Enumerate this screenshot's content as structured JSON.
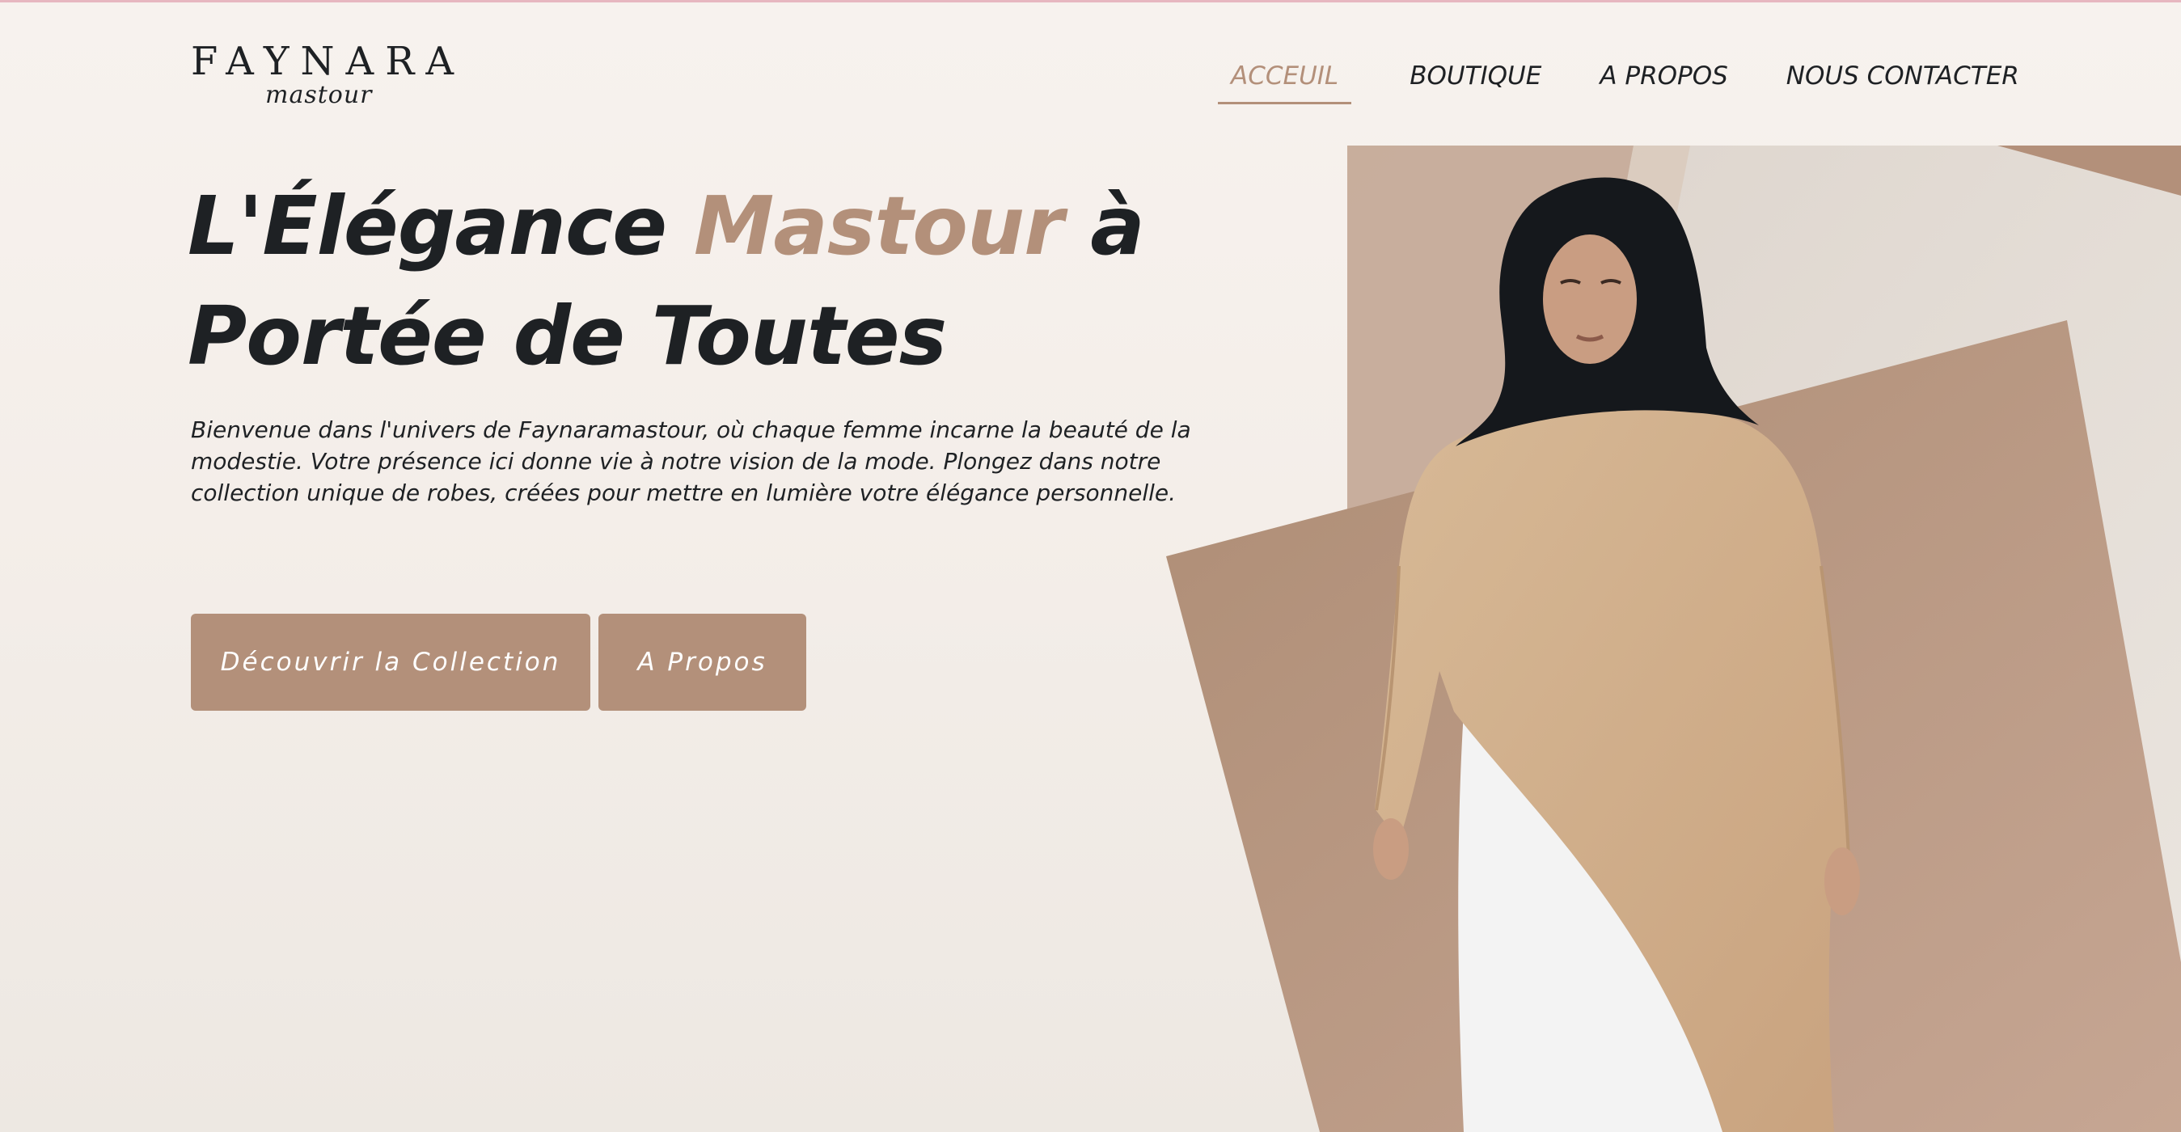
{
  "brand": {
    "name": "FAYNARA",
    "tagline": "mastour"
  },
  "nav": {
    "items": [
      {
        "label": "ACCEUIL",
        "active": true
      },
      {
        "label": "BOUTIQUE",
        "active": false
      },
      {
        "label": "A PROPOS",
        "active": false
      },
      {
        "label": "NOUS CONTACTER",
        "active": false
      }
    ]
  },
  "hero": {
    "title_part1": "L'Élégance ",
    "title_accent": "Mastour",
    "title_part2": " à Portée de Toutes",
    "description": "Bienvenue dans l'univers de Faynaramastour, où chaque femme incarne la beauté de la modestie. Votre présence ici donne vie à notre vision de la mode. Plongez dans notre collection unique de robes, créées pour mettre en lumière votre élégance personnelle.",
    "buttons": {
      "collection_label": "Découvrir la Collection",
      "about_label": "A Propos"
    },
    "image_subject": "model-wearing-beige-tunic-and-black-hijab"
  },
  "colors": {
    "accent": "#b3907a",
    "text": "#1e2124",
    "background": "#f7f2ee",
    "top_line": "#e7b7c0"
  }
}
